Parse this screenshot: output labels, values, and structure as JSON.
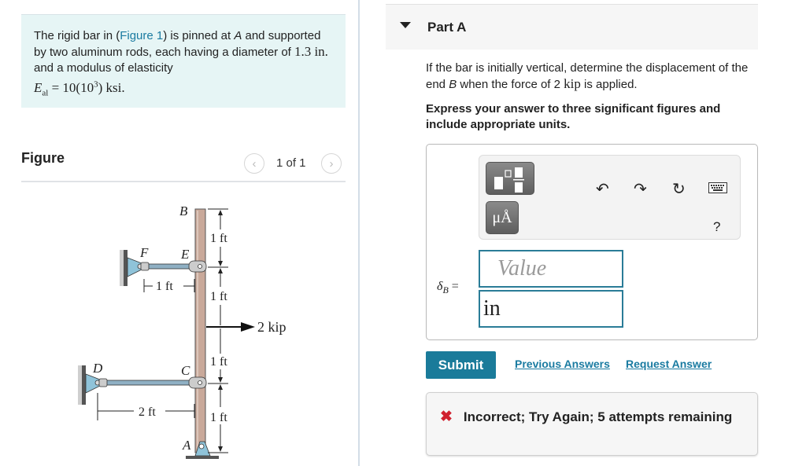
{
  "problem": {
    "text_before_link": "The rigid bar in (",
    "link_text": "Figure 1",
    "text_after_link": ") is pinned at ",
    "point_a": "A",
    "text_and": " and supported by two aluminum rods, each having a diameter of ",
    "diameter": "1.3",
    "diameter_unit": "in.",
    "text_modulus": " and a modulus of elasticity",
    "modulus_symbol": "E",
    "modulus_subscript": "al",
    "modulus_equals": " = 10(10",
    "modulus_exp": "3",
    "modulus_unit": ") ksi."
  },
  "figure": {
    "title": "Figure",
    "pager_text": "1 of 1",
    "prev_icon": "chevron-left-icon",
    "next_icon": "chevron-right-icon",
    "labels": {
      "B": "B",
      "E": "E",
      "F": "F",
      "C": "C",
      "D": "D",
      "A": "A",
      "dim_be": "1 ft",
      "dim_e_load": "1 ft",
      "dim_load_c": "1 ft",
      "dim_ca": "1 ft",
      "dim_fe": "1 ft",
      "dim_dc": "2 ft",
      "load": "2 kip"
    },
    "colors": {
      "bar": "#c9a99a",
      "rod": "#8fb0c4",
      "support": "#8fc3d9"
    }
  },
  "part": {
    "title": "Part A",
    "question_before": "If the bar is initially vertical, determine the displacement of the end ",
    "question_point": "B",
    "question_middle": " when the force of 2 ",
    "question_unit": "kip",
    "question_after": " is applied.",
    "instructions": "Express your answer to three significant figures and include appropriate units."
  },
  "answer": {
    "toolbar": {
      "templates_icon": "templates-icon",
      "units_label": "μÅ",
      "undo_glyph": "↶",
      "redo_glyph": "↷",
      "reset_glyph": "↻",
      "keyboard_glyph": "⌨",
      "help_label": "?"
    },
    "variable": "δ",
    "variable_sub": "B",
    "equals": " =",
    "value_placeholder": "Value",
    "value": "",
    "units_value": "in"
  },
  "actions": {
    "submit_label": "Submit",
    "previous_answers_label": "Previous Answers",
    "request_answer_label": "Request Answer"
  },
  "feedback": {
    "icon": "✖",
    "message": "Incorrect; Try Again; 5 attempts remaining",
    "color": "#d0202e"
  },
  "colors": {
    "accent": "#1a7b9a",
    "link": "#1a7ba1",
    "problem_bg": "#e6f5f5"
  }
}
